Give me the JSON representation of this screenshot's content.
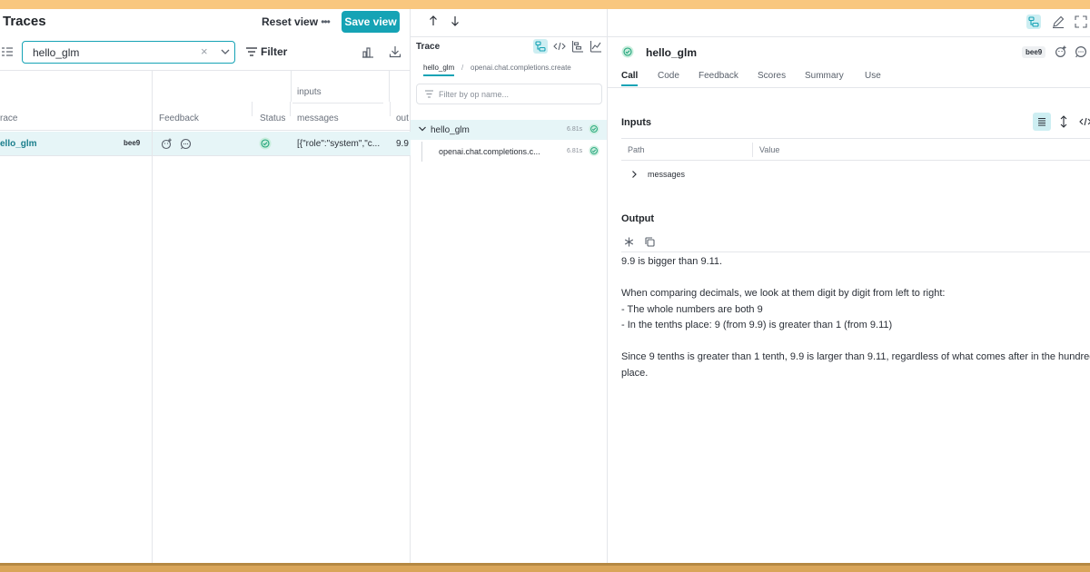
{
  "header": {
    "title": "Traces",
    "reset_label": "Reset view",
    "more_label": "•••",
    "save_label": "Save view"
  },
  "filter": {
    "search_value": "hello_glm",
    "clear_label": "×",
    "filter_label": "Filter"
  },
  "grid": {
    "group_header": "inputs",
    "columns": {
      "trace": "race",
      "feedback": "Feedback",
      "status": "Status",
      "messages": "messages",
      "output": "out"
    },
    "row": {
      "name": "ello_glm",
      "badge": "bee9",
      "messages": "[{\"role\":\"system\",\"c...",
      "output": "9.9"
    }
  },
  "trace_panel": {
    "label": "Trace",
    "breadcrumb": [
      "hello_glm",
      "openai.chat.completions.create"
    ],
    "breadcrumb_sep": "/",
    "filter_placeholder": "Filter by op name...",
    "nodes": [
      {
        "name": "hello_glm",
        "duration": "6.81s"
      },
      {
        "name": "openai.chat.completions.c...",
        "duration": "6.81s"
      }
    ]
  },
  "call": {
    "title": "hello_glm",
    "badge": "bee9",
    "tabs": [
      "Call",
      "Code",
      "Feedback",
      "Scores",
      "Summary",
      "Use"
    ],
    "inputs_heading": "Inputs",
    "path_header": "Path",
    "value_header": "Value",
    "input_row": "messages",
    "output_heading": "Output",
    "output_text": "9.9 is bigger than 9.11.\n\nWhen comparing decimals, we look at them digit by digit from left to right:\n- The whole numbers are both 9\n- In the tenths place: 9 (from 9.9) is greater than 1 (from 9.11)\n\nSince 9 tenths is greater than 1 tenth, 9.9 is larger than 9.11, regardless of what comes after in the hundreds\nplace."
  },
  "colors": {
    "accent": "#15a3b5",
    "selected_bg": "#e6f5f7",
    "success": "#1fa37a"
  }
}
